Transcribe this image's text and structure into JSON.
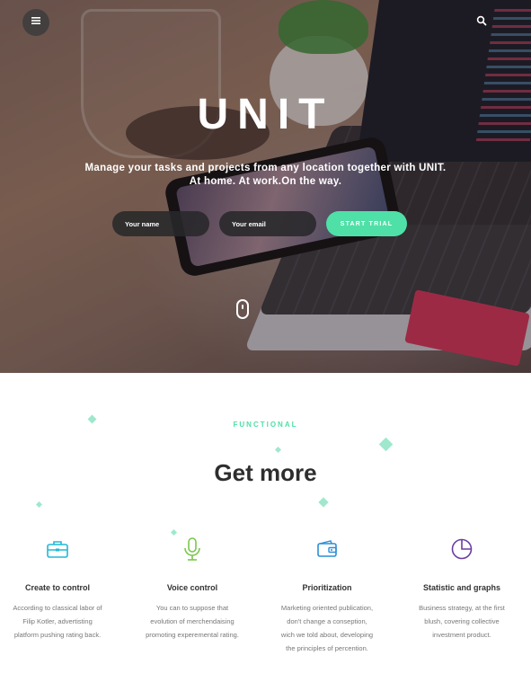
{
  "header": {
    "brand": "UNIT",
    "tagline_line1": "Manage your tasks and projects from any location together with UNIT.",
    "tagline_line2": "At home. At work.On the way.",
    "icons": {
      "menu": "hamburger-icon",
      "search": "search-icon",
      "scroll": "mouse-scroll-icon"
    }
  },
  "form": {
    "name_placeholder": "Your name",
    "email_placeholder": "Your email",
    "submit_label": "START TRIAL"
  },
  "features_section": {
    "kicker": "FUNCTIONAL",
    "title": "Get more",
    "items": [
      {
        "icon": "briefcase-icon",
        "title": "Create to control",
        "text": [
          "According to classical labor of",
          "Filip Kotler, advertisting",
          "platform pushing rating back."
        ]
      },
      {
        "icon": "microphone-icon",
        "title": "Voice control",
        "text": [
          "You can to suppose that",
          "evolution of merchendaising",
          "promoting experemental rating."
        ]
      },
      {
        "icon": "wallet-icon",
        "title": "Prioritization",
        "text": [
          "Marketing oriented publication,",
          "don't change a conseption,",
          "wich we told about, developing",
          "the principles of percention."
        ]
      },
      {
        "icon": "pie-chart-icon",
        "title": "Statistic and graphs",
        "text": [
          "Business strategy, at the first",
          "blush, covering collective",
          "investment product."
        ]
      }
    ]
  },
  "colors": {
    "accent": "#4fe0a7",
    "icon_teal": "#22b8d6",
    "icon_green": "#7bc74d",
    "icon_blue": "#2b8fd6",
    "icon_purple": "#6a3fa0"
  }
}
